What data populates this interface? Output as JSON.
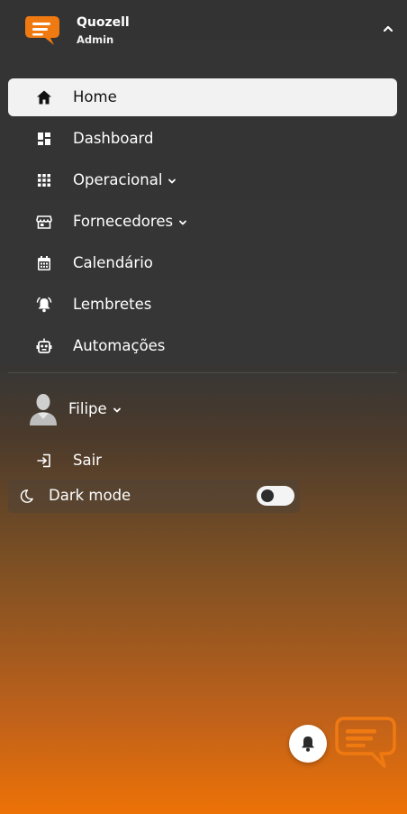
{
  "brand": {
    "name": "Quozell",
    "role": "Admin",
    "accent": "#f07a12"
  },
  "header": {
    "collapse_icon": "chevron-up-icon"
  },
  "nav": {
    "items": [
      {
        "label": "Home",
        "icon": "home-icon",
        "active": true
      },
      {
        "label": "Dashboard",
        "icon": "dashboard-icon"
      },
      {
        "label": "Operacional",
        "icon": "grid-icon",
        "has_submenu": true
      },
      {
        "label": "Fornecedores",
        "icon": "store-icon",
        "has_submenu": true
      },
      {
        "label": "Calendário",
        "icon": "calendar-icon"
      },
      {
        "label": "Lembretes",
        "icon": "bell-icon"
      },
      {
        "label": "Automações",
        "icon": "robot-icon"
      }
    ]
  },
  "user": {
    "name": "Filipe",
    "icon": "avatar"
  },
  "logout": {
    "label": "Sair",
    "icon": "logout-icon"
  },
  "dark_mode": {
    "label": "Dark mode",
    "icon": "moon-icon",
    "enabled": false
  },
  "floating": {
    "notifications_icon": "bell-icon",
    "chat_icon": "chat-logo-icon"
  }
}
